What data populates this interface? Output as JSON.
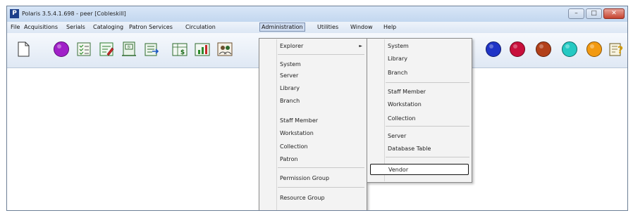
{
  "window": {
    "title": "Polaris 3.5.4.1.698 - peer [Cobleskill]",
    "app_icon_letter": "P",
    "controls": {
      "minimize": "–",
      "maximize": "□",
      "close": "✕"
    }
  },
  "menubar": {
    "items": [
      "File",
      "Acquisitions",
      "Serials",
      "Cataloging",
      "Patron Services",
      "Circulation",
      "Administration",
      "Utilities",
      "Window",
      "Help"
    ],
    "active": "Administration"
  },
  "toolbar": {
    "icons": [
      {
        "name": "new-document-icon"
      },
      {
        "name": "purple-circle-icon",
        "color": "#a020c8"
      },
      {
        "name": "checklist-icon"
      },
      {
        "name": "edit-record-icon"
      },
      {
        "name": "bibliographic-record-icon"
      },
      {
        "name": "import-record-icon"
      },
      {
        "name": "financial-report-icon"
      },
      {
        "name": "statistics-report-icon"
      },
      {
        "name": "patron-group-icon"
      },
      {
        "name": "blue-circle-icon",
        "color": "#1f34c6"
      },
      {
        "name": "crimson-circle-icon",
        "color": "#c8103c"
      },
      {
        "name": "brown-circle-icon",
        "color": "#b2401a"
      },
      {
        "name": "teal-circle-icon",
        "color": "#25c9c3"
      },
      {
        "name": "orange-circle-icon",
        "color": "#f29a12"
      },
      {
        "name": "help-icon"
      }
    ]
  },
  "administration_menu": {
    "items": [
      "Explorer",
      "System",
      "Server",
      "Library",
      "Branch",
      "Staff Member",
      "Workstation",
      "Collection",
      "Patron",
      "Permission Group",
      "Resource Group"
    ],
    "submenu_arrow": "►"
  },
  "explorer_submenu": {
    "items": [
      "System",
      "Library",
      "Branch",
      "Staff Member",
      "Workstation",
      "Collection",
      "Server",
      "Database Table",
      "Vendor"
    ],
    "highlighted": "Vendor"
  }
}
